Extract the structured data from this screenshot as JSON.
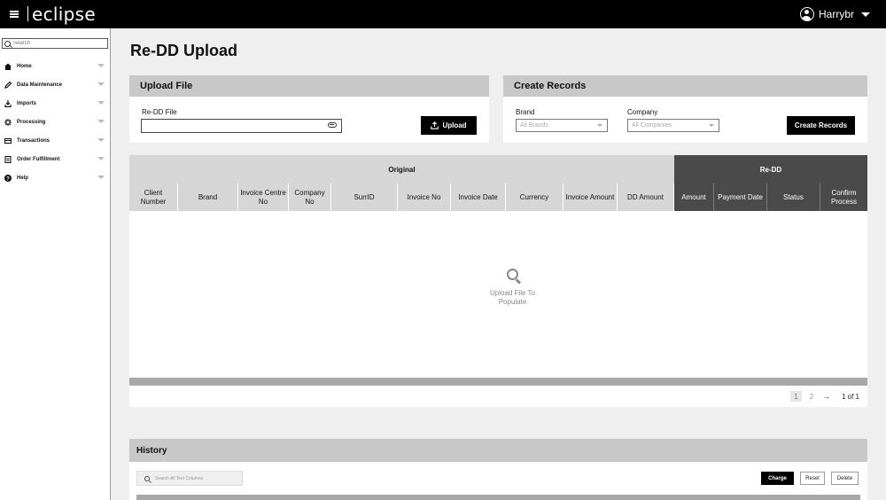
{
  "app": {
    "logo": "eclipse",
    "user": "Harrybr"
  },
  "sidebar": {
    "search_placeholder": "Search",
    "items": [
      {
        "label": "Home",
        "icon": "home-icon"
      },
      {
        "label": "Data Maintenance",
        "icon": "pencil-icon"
      },
      {
        "label": "Imports",
        "icon": "import-icon"
      },
      {
        "label": "Processing",
        "icon": "gear-icon"
      },
      {
        "label": "Transactions",
        "icon": "card-icon"
      },
      {
        "label": "Order Fulfillment",
        "icon": "document-icon"
      },
      {
        "label": "Help",
        "icon": "help-icon"
      }
    ]
  },
  "page": {
    "title": "Re-DD Upload"
  },
  "upload": {
    "header": "Upload File",
    "file_label": "Re-DD File",
    "file_value": "",
    "button": "Upload"
  },
  "create": {
    "header": "Create Records",
    "brand_label": "Brand",
    "brand_value": "All Brands",
    "company_label": "Company",
    "company_value": "All Companies",
    "button": "Create Records"
  },
  "table": {
    "group_original": "Original",
    "group_redd": "Re-DD",
    "original_columns": [
      "Client Number",
      "Brand",
      "Invoice Centre No",
      "Company No",
      "SurrID",
      "Invoice No",
      "Invoice Date",
      "Currency",
      "Invoice Amount",
      "DD Amount"
    ],
    "redd_columns": [
      "Amount",
      "Payment Date",
      "Status",
      "Confirm Process"
    ],
    "empty_message": "Upload File To Populate",
    "pager": {
      "page1": "1",
      "page2": "2",
      "next": "→",
      "summary": "1 of 1"
    }
  },
  "history": {
    "header": "History",
    "search_placeholder": "Search All Text Columns",
    "buttons": {
      "charge": "Charge",
      "reset": "Reset",
      "delete": "Delete"
    }
  }
}
